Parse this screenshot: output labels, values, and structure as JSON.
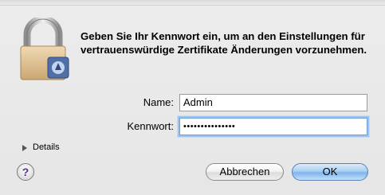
{
  "dialog": {
    "message": "Geben Sie Ihr Kennwort ein, um an den Einstellungen für vertrauenswürdige Zertifikate Änderungen vorzunehmen."
  },
  "form": {
    "name_label": "Name:",
    "name_value": "Admin",
    "password_label": "Kennwort:",
    "password_value": "•••••••••••••••"
  },
  "details": {
    "label": "Details"
  },
  "buttons": {
    "help_label": "?",
    "cancel_label": "Abbrechen",
    "ok_label": "OK"
  },
  "icons": {
    "lock": "lock-icon",
    "details_toggle": "disclosure-triangle-icon"
  },
  "colors": {
    "default_button": "#7fb4ea",
    "focus_ring": "#9bc3f0"
  }
}
